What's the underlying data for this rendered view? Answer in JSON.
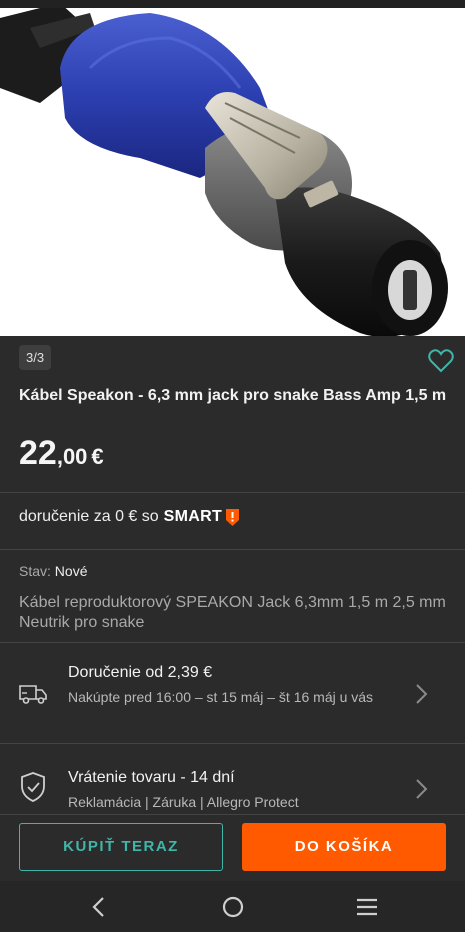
{
  "gallery": {
    "counter": "3/3"
  },
  "product": {
    "title": "Kábel Speakon - 6,3 mm jack pro snake Bass Amp 1,5 m",
    "price_int": "22",
    "price_dec": ",00",
    "currency": "€"
  },
  "delivery_free": {
    "text": "doručenie za 0 € so",
    "brand": "SMART",
    "brand_color": "#ff5a00"
  },
  "condition": {
    "label": "Stav:",
    "value": "Nové"
  },
  "description": "Kábel reproduktorový SPEAKON Jack 6,3mm 1,5 m 2,5 mm Neutrik pro snake",
  "shipping": {
    "title": "Doručenie od 2,39 €",
    "subtitle": "Nakúpte pred 16:00 – st 15 máj – št 16 máj u vás",
    "icon": "truck-icon"
  },
  "returns": {
    "title": "Vrátenie tovaru - 14 dní",
    "subtitle": "Reklamácia | Záruka | Allegro Protect",
    "icon": "shield-check-icon"
  },
  "actions": {
    "buy_now": "KÚPIŤ TERAZ",
    "add_to_cart": "DO KOŠÍKA",
    "accent": "#3fb6a8",
    "cart_color": "#ff5a00"
  },
  "navbar": {
    "icons": [
      "back-icon",
      "home-icon",
      "menu-icon"
    ]
  }
}
